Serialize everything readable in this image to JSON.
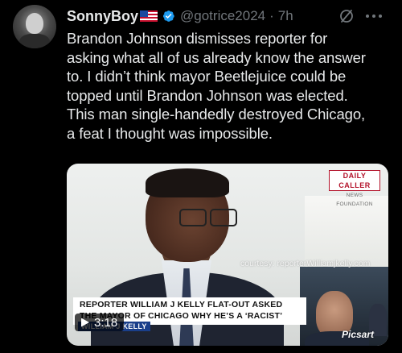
{
  "post": {
    "display_name": "SonnyBoy",
    "flag_icon": "us-flag-icon",
    "handle": "@gotrice2024",
    "separator": "·",
    "time": "7h",
    "text_lines": [
      "Brandon Johnson dismisses reporter for",
      "asking what all of us already know the answer",
      "to. I didn’t think mayor Beetlejuice could be",
      "topped until Brandon Johnson was elected.",
      "This man single-handedly destroyed Chicago,",
      "a feat I thought was impossible."
    ]
  },
  "media": {
    "logo_main": "DAILY CALLER",
    "logo_sub": "NEWS FOUNDATION",
    "courtesy": "courtesy: reporterWilliamjkelly.com",
    "banner_line1": "REPORTER WILLIAM J KELLY FLAT-OUT ASKED",
    "banner_line2": "THE MAYOR OF CHICAGO WHY HE’S A ‘RACIST’",
    "banner_sub": "WILLIAM J KELLY",
    "duration": "3:18",
    "watermark": "Picsart"
  },
  "colors": {
    "background": "#000000",
    "text_primary": "#e7e9ea",
    "text_secondary": "#71767b",
    "verified": "#1d9bf0"
  }
}
